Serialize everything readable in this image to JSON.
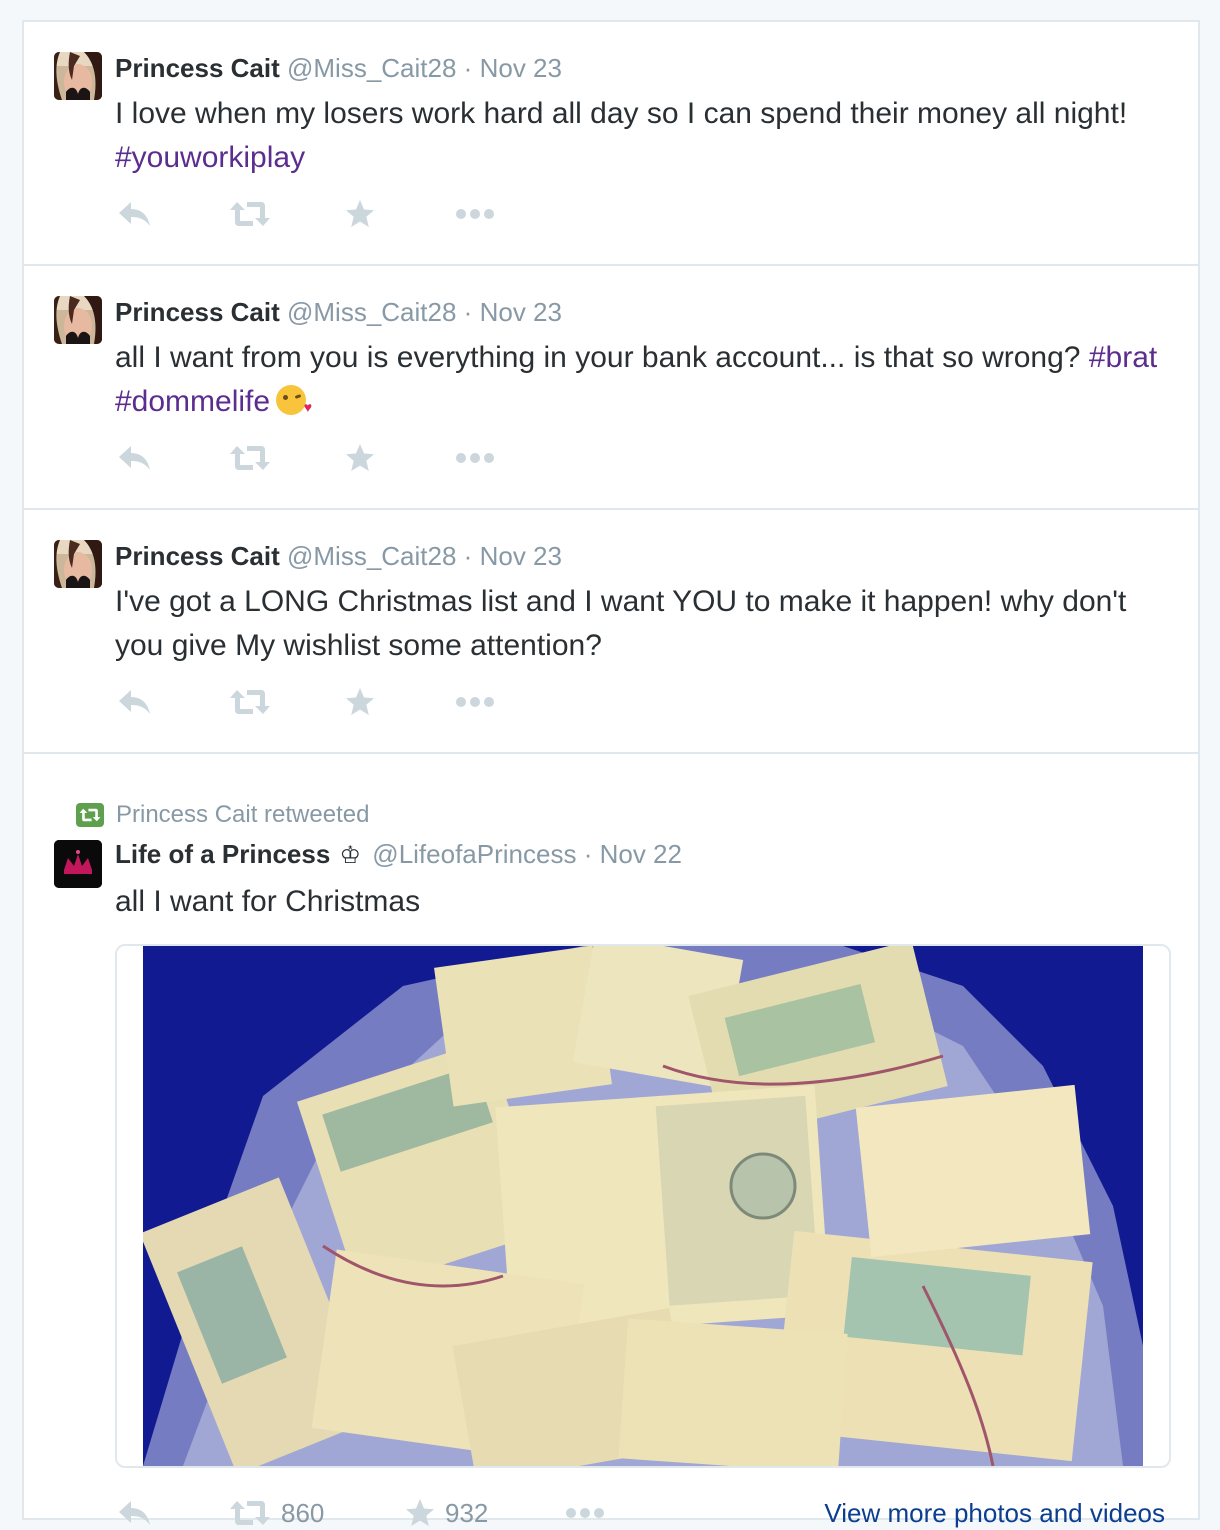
{
  "tweets": [
    {
      "author": {
        "fullname": "Princess Cait",
        "username": "@Miss_Cait28"
      },
      "separator": "·",
      "time": "Nov 23",
      "text": "I love when my losers work hard all day so I can spend their money all night! ",
      "hashtags": [
        "#youworkiplay"
      ]
    },
    {
      "author": {
        "fullname": "Princess Cait",
        "username": "@Miss_Cait28"
      },
      "separator": "·",
      "time": "Nov 23",
      "text": "all I want from you is everything in your bank account... is that so wrong? ",
      "hashtags": [
        "#brat",
        "#dommelife"
      ],
      "emoji": "kissing-face-emoji"
    },
    {
      "author": {
        "fullname": "Princess Cait",
        "username": "@Miss_Cait28"
      },
      "separator": "·",
      "time": "Nov 23",
      "text": "I've got a LONG Christmas list and I want YOU to make it happen! why don't you give My wishlist some attention?"
    },
    {
      "retweet_context": "Princess Cait retweeted",
      "author": {
        "fullname": "Life of a Princess",
        "badge": "♔",
        "username": "@LifeofaPrincess"
      },
      "separator": "·",
      "time": "Nov 22",
      "text": "all I want for Christmas",
      "media": "photo of bundled dollar bills in a plastic bag",
      "retweet_count": "860",
      "favorite_count": "932",
      "view_more": "View more photos and videos"
    }
  ],
  "icons": {
    "reply": "reply-icon",
    "retweet": "retweet-icon",
    "favorite": "star-icon",
    "more": "more-dots-icon"
  },
  "colors": {
    "hashtag": "#5b2d8e",
    "link": "#0b3d91",
    "muted": "#8899a6",
    "action_icon": "#ccd6dd",
    "retweet_badge": "#5fa04e"
  }
}
